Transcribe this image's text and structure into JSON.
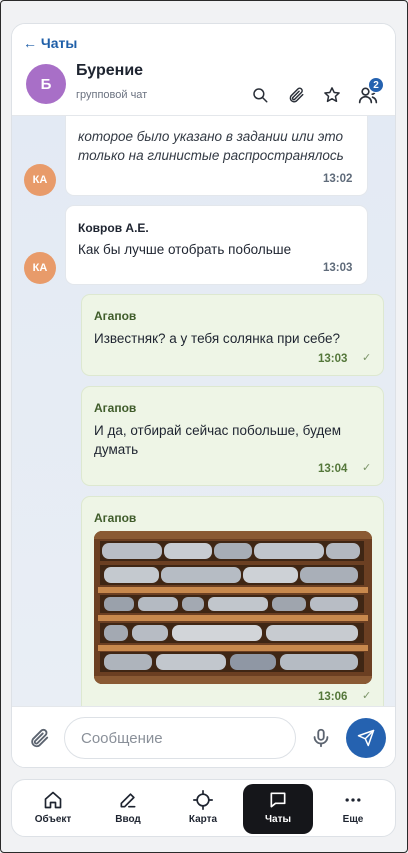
{
  "header": {
    "back_label": "← Чаты",
    "avatar_letter": "Б",
    "title": "Бурение",
    "subtitle": "групповой чат",
    "participants_count": "2",
    "icons": [
      "search-icon",
      "paperclip-icon",
      "star-icon",
      "users-icon"
    ]
  },
  "messages": [
    {
      "direction": "in",
      "avatar": "КА",
      "text_lines": [
        "которое было указано в задании или это",
        "только на глинистые распространялось"
      ],
      "time": "13:02"
    },
    {
      "direction": "in",
      "avatar": "КА",
      "sender": "Ковров А.Е.",
      "text": "Как бы лучше отобрать побольше",
      "time": "13:03"
    },
    {
      "direction": "out",
      "sender": "Агапов",
      "text": "Известняк? а у тебя солянка при себе?",
      "time": "13:03",
      "status": "✓"
    },
    {
      "direction": "out",
      "sender": "Агапов",
      "text_lines": [
        "И да, отбирай сейчас побольше, будем",
        "думать"
      ],
      "time": "13:04",
      "status": "✓"
    },
    {
      "direction": "out",
      "sender": "Агапов",
      "image": "core-sample-box-photo",
      "time": "13:06",
      "status": "✓"
    }
  ],
  "composer": {
    "placeholder": "Сообщение"
  },
  "nav": [
    {
      "label": "Объект",
      "icon": "home-icon",
      "active": false
    },
    {
      "label": "Ввод",
      "icon": "pen-icon",
      "active": false
    },
    {
      "label": "Карта",
      "icon": "crosshair-icon",
      "active": false
    },
    {
      "label": "Чаты",
      "icon": "chat-icon",
      "active": true
    },
    {
      "label": "Еще",
      "icon": "more-icon",
      "active": false
    }
  ],
  "colors": {
    "accent": "#2562b0",
    "avatar_group": "#a86fc7",
    "avatar_user": "#e89b6a",
    "outgoing_bubble": "#eef5e6",
    "nav_active": "#15161a"
  }
}
